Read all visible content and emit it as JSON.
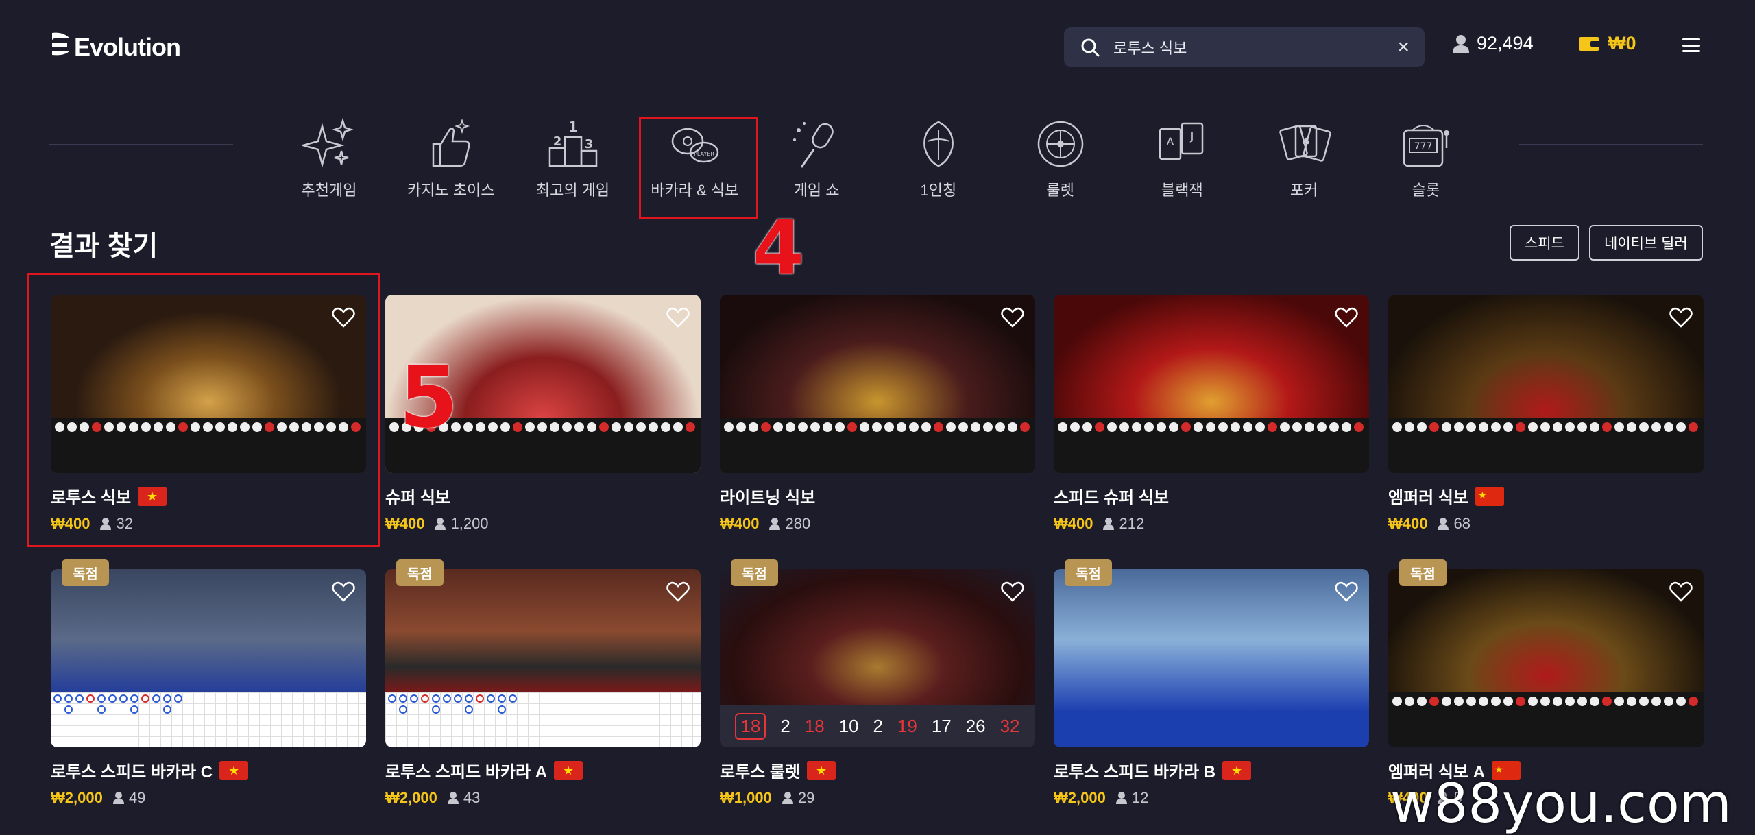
{
  "header": {
    "logo_text": "Evolution",
    "search_query": "로투스 식보",
    "clear_icon": "×",
    "player_count": "92,494",
    "wallet_balance": "₩0"
  },
  "categories": [
    {
      "label": "추천게임",
      "icon": "sparkles-icon"
    },
    {
      "label": "카지노 초이스",
      "icon": "thumbs-up-icon"
    },
    {
      "label": "최고의 게임",
      "icon": "podium-icon"
    },
    {
      "label": "바카라 & 식보",
      "icon": "baccarat-chips-icon"
    },
    {
      "label": "게임 쇼",
      "icon": "microphone-icon"
    },
    {
      "label": "1인칭",
      "icon": "first-person-icon"
    },
    {
      "label": "룰렛",
      "icon": "roulette-icon"
    },
    {
      "label": "블랙잭",
      "icon": "blackjack-cards-icon"
    },
    {
      "label": "포커",
      "icon": "poker-cards-icon"
    },
    {
      "label": "슬롯",
      "icon": "slot-machine-icon"
    }
  ],
  "annotations": {
    "step4": "4",
    "step5": "5"
  },
  "results": {
    "title": "결과 찾기",
    "filters": [
      "스피드",
      "네이티브 딜러"
    ]
  },
  "games": [
    {
      "name": "로투스 식보",
      "price": "₩400",
      "players": "32",
      "flag": "vn",
      "badge": "",
      "theme": "lotus"
    },
    {
      "name": "슈퍼 식보",
      "price": "₩400",
      "players": "1,200",
      "flag": "",
      "badge": "",
      "theme": "super"
    },
    {
      "name": "라이트닝 식보",
      "price": "₩400",
      "players": "280",
      "flag": "",
      "badge": "",
      "theme": "lightning"
    },
    {
      "name": "스피드 슈퍼 식보",
      "price": "₩400",
      "players": "212",
      "flag": "",
      "badge": "",
      "theme": "speed"
    },
    {
      "name": "엠퍼러 식보",
      "price": "₩400",
      "players": "68",
      "flag": "cn",
      "badge": "",
      "theme": "emperor"
    },
    {
      "name": "로투스 스피드 바카라 C",
      "price": "₩2,000",
      "players": "49",
      "flag": "vn",
      "badge": "독점",
      "theme": "baccaratC"
    },
    {
      "name": "로투스 스피드 바카라 A",
      "price": "₩2,000",
      "players": "43",
      "flag": "vn",
      "badge": "독점",
      "theme": "baccaratA"
    },
    {
      "name": "로투스 룰렛",
      "price": "₩1,000",
      "players": "29",
      "flag": "vn",
      "badge": "독점",
      "theme": "roulette"
    },
    {
      "name": "로투스 스피드 바카라 B",
      "price": "₩2,000",
      "players": "12",
      "flag": "vn",
      "badge": "독점",
      "theme": "baccaratB"
    },
    {
      "name": "엠퍼러 식보 A",
      "price": "₩400",
      "players": "5",
      "flag": "cn",
      "badge": "독점",
      "theme": "emperorA"
    }
  ],
  "roulette_history": [
    "18",
    "2",
    "18",
    "10",
    "2",
    "19",
    "17",
    "26",
    "32"
  ],
  "watermark": "w88you.com",
  "colors": {
    "background": "#1c1c2b",
    "accent_gold": "#f5c518",
    "highlight_red": "#e0161e",
    "badge_gold": "#b89552"
  }
}
